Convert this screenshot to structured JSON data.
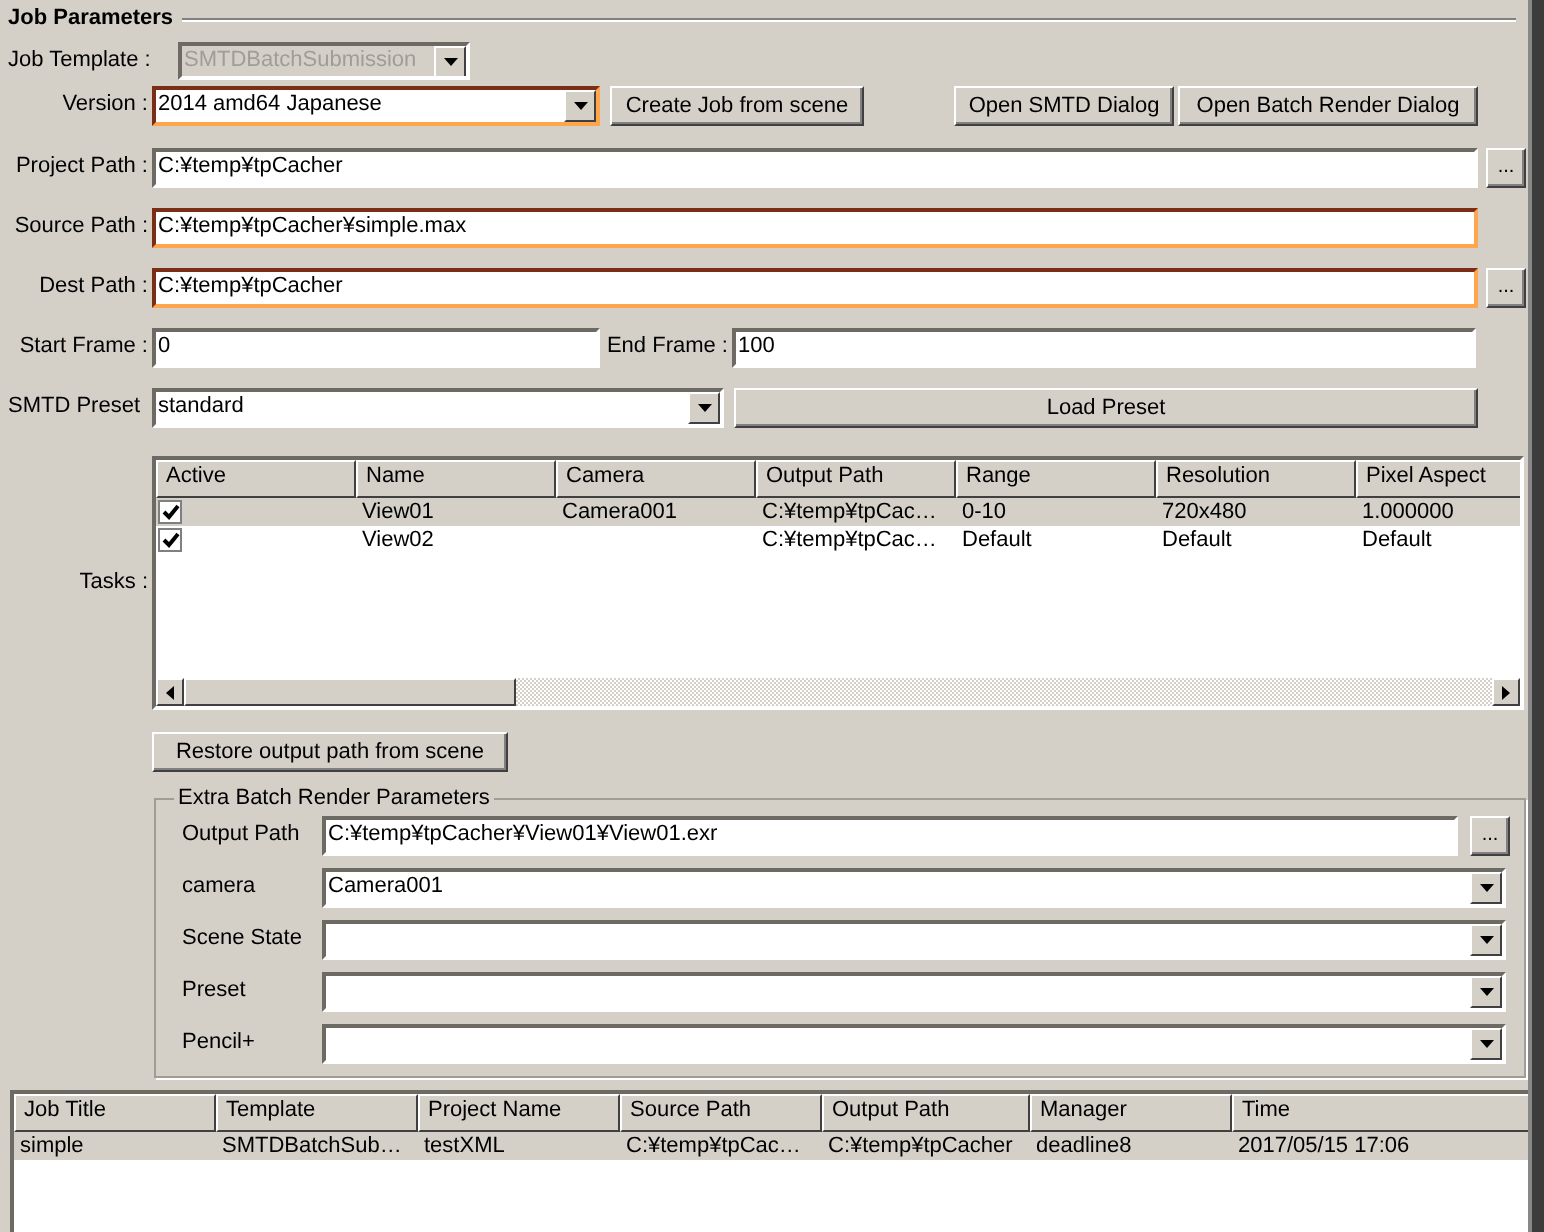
{
  "group_title": "Job Parameters",
  "job_template": {
    "label": "Job Template :",
    "value": "SMTDBatchSubmission",
    "disabled": true
  },
  "version": {
    "label": "Version :",
    "value": "2014 amd64 Japanese",
    "highlighted": true
  },
  "create_button": {
    "label": "Create Job from scene"
  },
  "dialog_buttons": [
    {
      "label": "Open SMTD Dialog"
    },
    {
      "label": "Open Batch Render Dialog"
    }
  ],
  "paths": [
    {
      "label": "Project Path :",
      "value": "C:¥temp¥tpCacher",
      "highlighted": false,
      "browse": "..."
    },
    {
      "label": "Source Path :",
      "value": "C:¥temp¥tpCacher¥simple.max",
      "highlighted": true
    },
    {
      "label": "Dest Path :",
      "value": "C:¥temp¥tpCacher",
      "highlighted": true,
      "browse": "..."
    }
  ],
  "start_frame": {
    "label": "Start Frame :",
    "value": "0"
  },
  "end_frame": {
    "label": "End Frame :",
    "value": "100"
  },
  "preset": {
    "label": "SMTD Preset",
    "value": "standard",
    "button": "Load Preset"
  },
  "tasks": {
    "label": "Tasks :",
    "columns": [
      "Active",
      "Name",
      "Camera",
      "Output Path",
      "Range",
      "Resolution",
      "Pixel Aspect"
    ],
    "rows": [
      {
        "checked": true,
        "selected": true,
        "cells": [
          "",
          "View01",
          "Camera001",
          "C:¥temp¥tpCac…",
          "0-10",
          "720x480",
          "1.000000"
        ]
      },
      {
        "checked": true,
        "selected": false,
        "cells": [
          "",
          "View02",
          "",
          "C:¥temp¥tpCac…",
          "Default",
          "Default",
          "Default"
        ]
      }
    ]
  },
  "restore_button": {
    "label": "Restore output path from scene"
  },
  "extra": {
    "title": "Extra Batch Render Parameters",
    "fields": [
      {
        "kind": "text",
        "label": "Output Path",
        "value": "C:¥temp¥tpCacher¥View01¥View01.exr",
        "browse": "..."
      },
      {
        "kind": "combo",
        "label": "camera",
        "value": "Camera001"
      },
      {
        "kind": "combo",
        "label": "Scene State"
      },
      {
        "kind": "combo",
        "label": "Preset"
      },
      {
        "kind": "combo",
        "label": "Pencil+"
      }
    ]
  },
  "jobs": {
    "columns": [
      "Job Title",
      "Template",
      "Project Name",
      "Source Path",
      "Output Path",
      "Manager",
      "Time"
    ],
    "rows": [
      {
        "selected": true,
        "cells": [
          "simple",
          "SMTDBatchSub…",
          "testXML",
          "C:¥temp¥tpCac…",
          "C:¥temp¥tpCacher",
          "deadline8",
          "2017/05/15 17:06"
        ]
      }
    ]
  }
}
